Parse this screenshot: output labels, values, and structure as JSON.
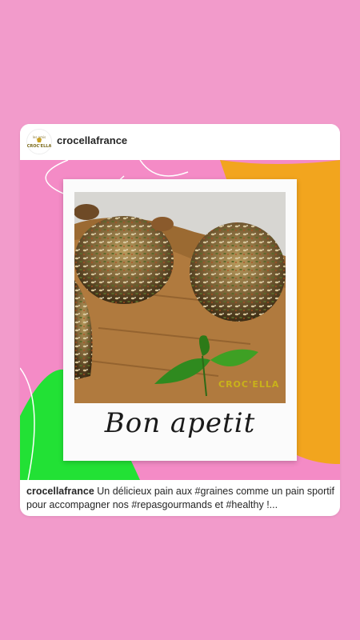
{
  "post": {
    "username": "crocellafrance",
    "avatar_logo": "Croc'ella logo",
    "caption_user": "crocellafrance",
    "caption_text": "Un délicieux pain aux #graines comme un pain sportif pour accompagner nos #repasgourmands et #healthy !..."
  },
  "image": {
    "overlay_text": "Bon apetit",
    "brand_watermark": "CROC'ELLA"
  },
  "colors": {
    "background": "#f29bcb",
    "orange_shape": "#f2a51e",
    "green_shape": "#22e135",
    "pink_shape": "#f48bc6"
  }
}
